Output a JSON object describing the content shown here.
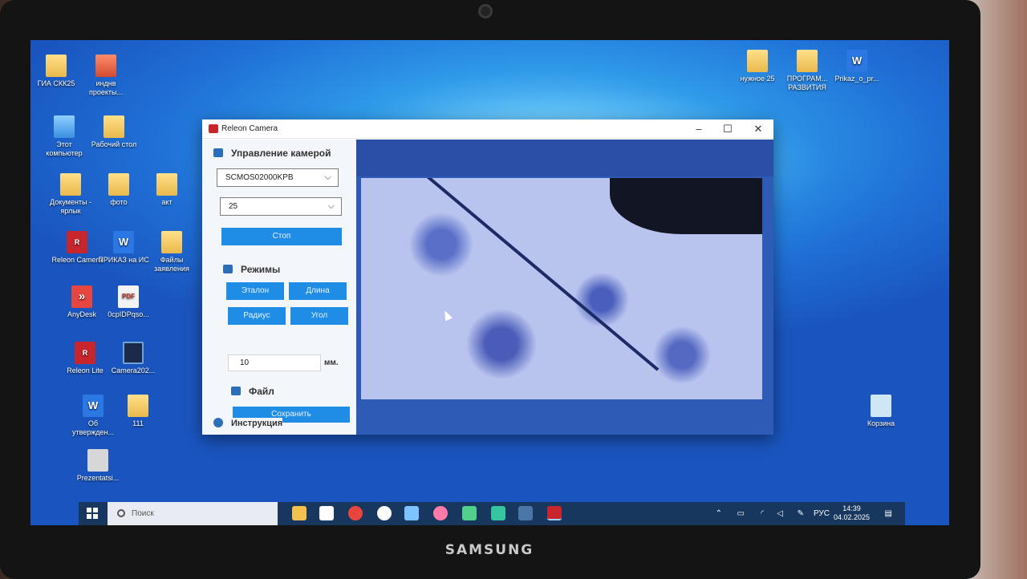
{
  "desktop": {
    "icons_left": [
      {
        "label": "ГИА СКК25",
        "kind": "folder"
      },
      {
        "label": "инднв проекты...",
        "kind": "folder-red"
      },
      {
        "label": "Этот компьютер",
        "kind": "pc"
      },
      {
        "label": "Рабочий стол",
        "kind": "folder"
      },
      {
        "label": "Документы - ярлык",
        "kind": "folder"
      },
      {
        "label": "фото",
        "kind": "folder"
      },
      {
        "label": "акт",
        "kind": "folder"
      },
      {
        "label": "Releon Camera",
        "kind": "releon"
      },
      {
        "label": "ПРИКАЗ на ИС",
        "kind": "word"
      },
      {
        "label": "Файлы заявления",
        "kind": "folder"
      },
      {
        "label": "AnyDesk",
        "kind": "anydesk"
      },
      {
        "label": "0cpIDPqso...",
        "kind": "doc"
      },
      {
        "label": "Releon Lite",
        "kind": "releon"
      },
      {
        "label": "Camera202...",
        "kind": "cam"
      },
      {
        "label": "Об утвержден...",
        "kind": "word"
      },
      {
        "label": "111",
        "kind": "folder"
      },
      {
        "label": "Prezentatsi...",
        "kind": "pres"
      }
    ],
    "icons_right": [
      {
        "label": "нужное 25",
        "kind": "folder"
      },
      {
        "label": "ПРОГРАМ... РАЗВИТИЯ",
        "kind": "folder"
      },
      {
        "label": "Prikaz_o_pr...",
        "kind": "word"
      },
      {
        "label": "Корзина",
        "kind": "bin"
      }
    ]
  },
  "app": {
    "title": "Releon Camera",
    "camera_section": "Управление камерой",
    "camera_select": "SCMOS02000KPB",
    "rate_select": "25",
    "stop_button": "Стоп",
    "modes_section": "Режимы",
    "modes": [
      "Эталон",
      "Длина",
      "Радиус",
      "Угол"
    ],
    "length_value": "10",
    "unit": "мм.",
    "file_section": "Файл",
    "save_button": "Сохранить",
    "help_section": "Инструкция"
  },
  "taskbar": {
    "search_placeholder": "Поиск",
    "apps": [
      "file-explorer",
      "word-app",
      "yandex",
      "yandex-browser",
      "app-tiles",
      "app-pink",
      "app-heart",
      "app-green",
      "vk",
      "releon-camera"
    ],
    "language": "РУС",
    "time": "14:39",
    "date": "04.02.2025"
  },
  "device": {
    "brand": "SAMSUNG"
  },
  "colors": {
    "accent": "#1f8ce6",
    "taskbar": "#17375f",
    "desktop": "#1f6fd6"
  }
}
